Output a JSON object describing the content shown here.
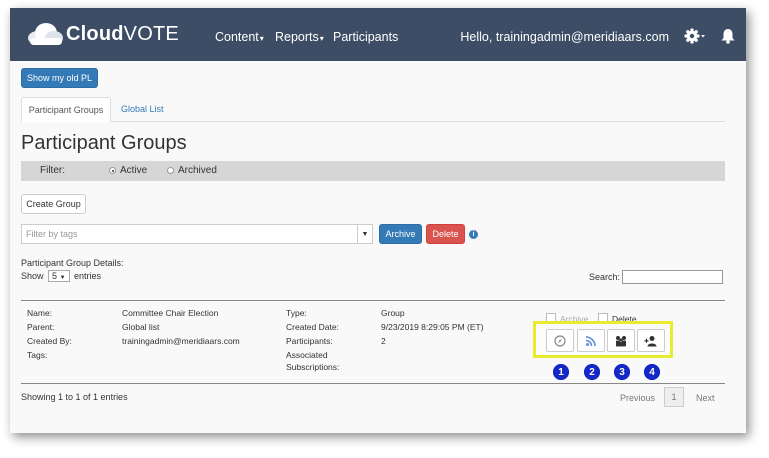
{
  "app": {
    "logo_word1": "Cloud",
    "logo_word2": "VOTE",
    "nav": [
      {
        "label": "Content"
      },
      {
        "label": "Reports"
      },
      {
        "label": "Participants"
      }
    ],
    "greeting": "Hello, trainingadmin@meridiaars.com",
    "icons": {
      "settings": "gear-icon",
      "notifications": "bell-icon"
    },
    "colors": {
      "navbar": "#3d4d66",
      "primary": "#337ab7",
      "danger": "#d9534f",
      "highlight": "#e9ec2e",
      "callout": "#1428c8"
    }
  },
  "toolbar": {
    "old_pl_button": "Show my old PL"
  },
  "tabs": [
    {
      "label": "Participant Groups",
      "active": true
    },
    {
      "label": "Global List",
      "active": false
    }
  ],
  "page": {
    "title": "Participant Groups",
    "filter": {
      "label": "Filter:",
      "options": [
        "Active",
        "Archived"
      ],
      "selected": "Active"
    },
    "create_button": "Create Group",
    "tag_filter_placeholder": "Filter by tags",
    "archive_button": "Archive",
    "delete_button": "Delete",
    "details_label": "Participant Group Details:",
    "show_label": "Show",
    "entries_value": "5",
    "entries_label": "entries",
    "search_label": "Search:"
  },
  "group": {
    "left": [
      {
        "label": "Name:",
        "value": "Committee Chair Election"
      },
      {
        "label": "Parent:",
        "value": "Global list"
      },
      {
        "label": "Created By:",
        "value": "trainingadmin@meridiaars.com"
      },
      {
        "label": "Tags:",
        "value": ""
      }
    ],
    "right": [
      {
        "label": "Type:",
        "value": "Group"
      },
      {
        "label": "Created Date:",
        "value": "9/23/2019 8:29:05 PM (ET)"
      },
      {
        "label": "Participants:",
        "value": "2"
      },
      {
        "label": "Associated",
        "value": ""
      },
      {
        "label": "Subscriptions:",
        "value": ""
      }
    ],
    "archive_check": "Archive",
    "delete_check": "Delete",
    "action_icons": [
      "compass-icon",
      "rss-icon",
      "group-icon",
      "add-user-icon"
    ],
    "callouts": [
      "1",
      "2",
      "3",
      "4"
    ]
  },
  "footer": {
    "showing": "Showing 1 to 1 of 1 entries",
    "previous": "Previous",
    "page": "1",
    "next": "Next"
  }
}
